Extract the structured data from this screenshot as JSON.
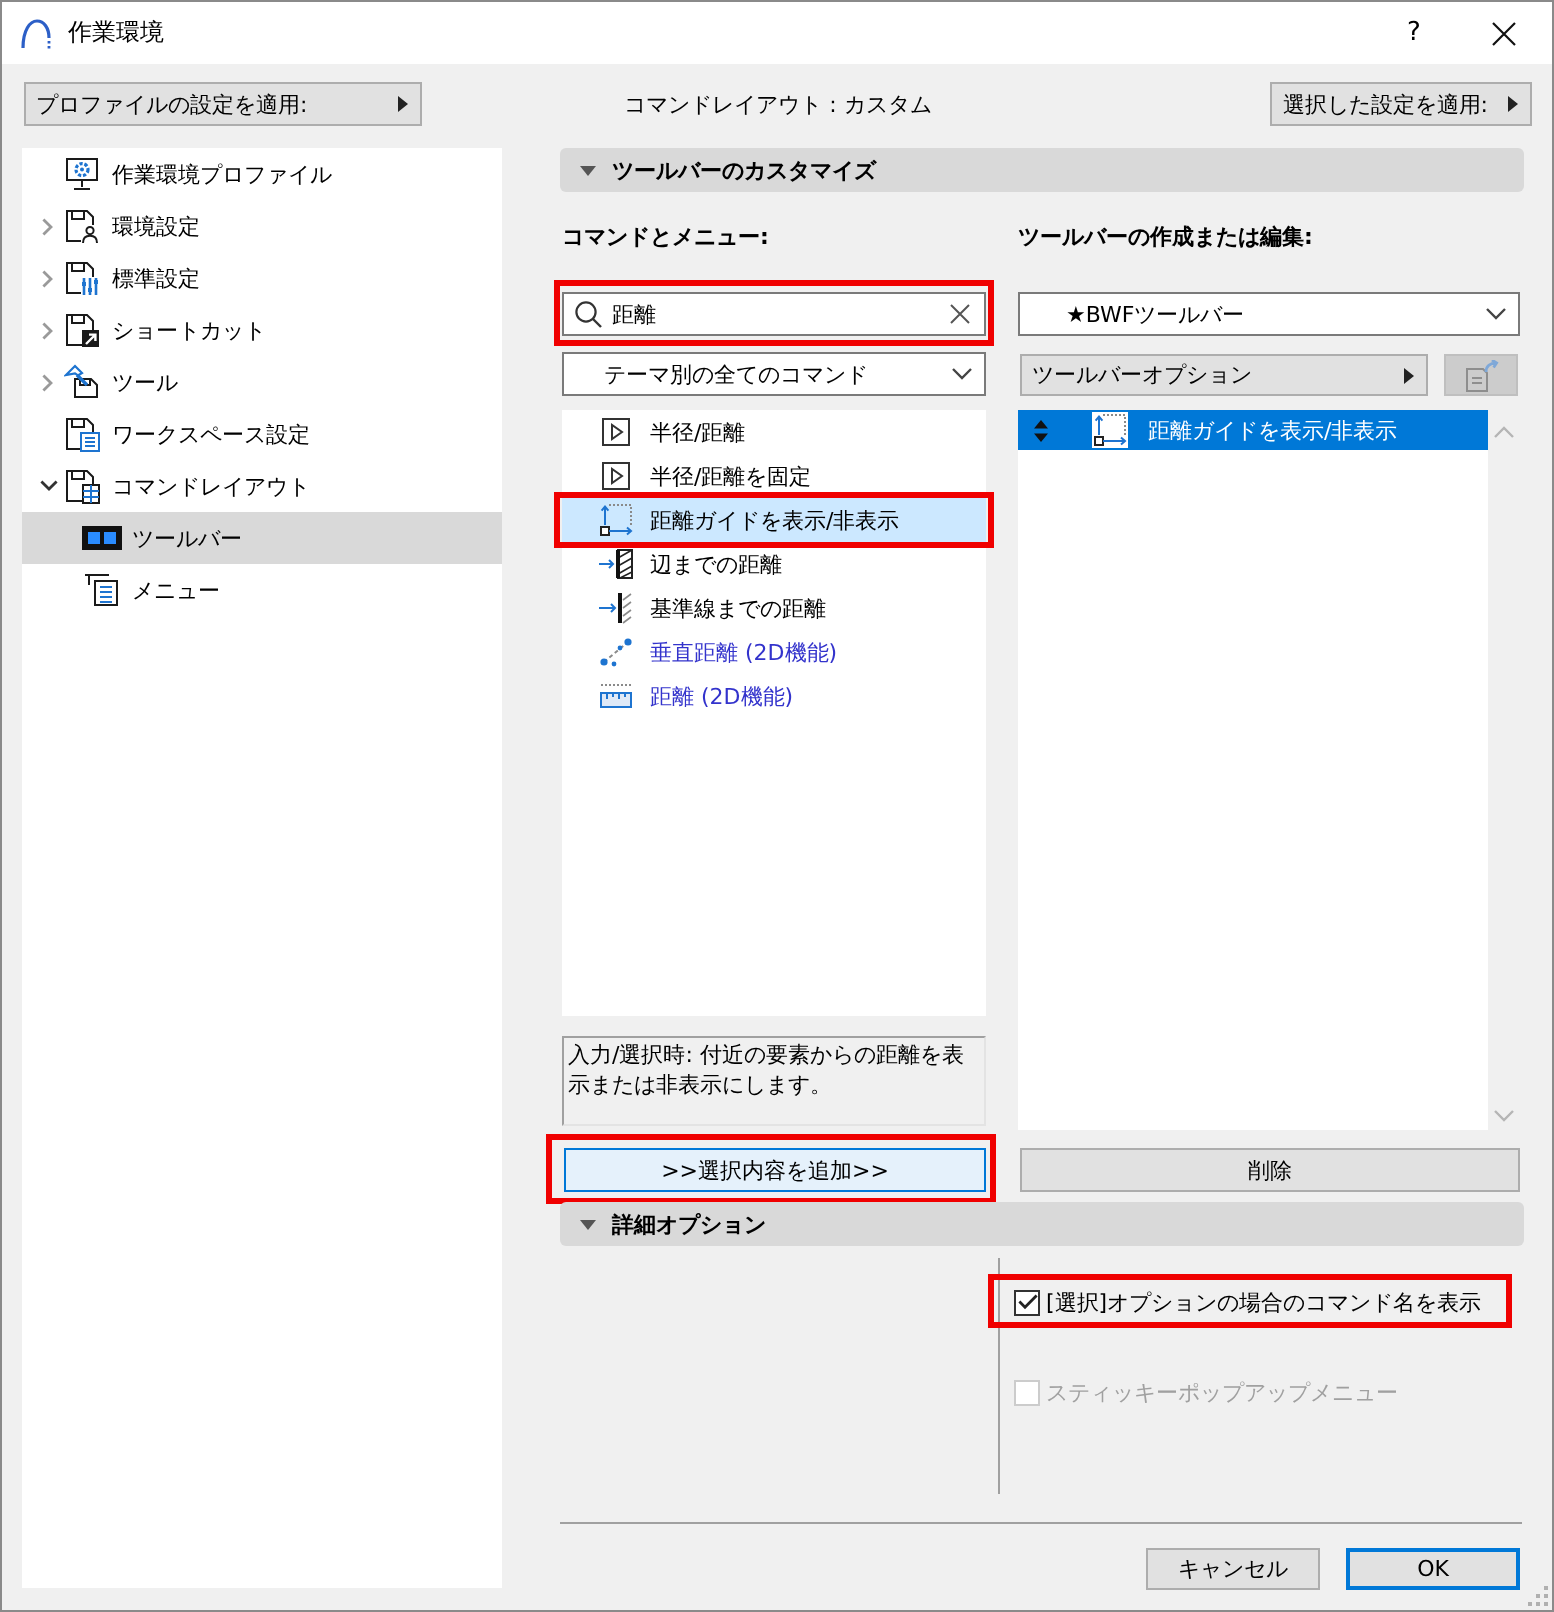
{
  "window": {
    "title": "作業環境",
    "help_button": "?"
  },
  "toolbar": {
    "profile_button": "プロファイルの設定を適用:",
    "layout_status": "コマンドレイアウト : カスタム",
    "apply_button": "選択した設定を適用:"
  },
  "sidebar": {
    "items": [
      {
        "label": "作業環境プロファイル",
        "selected": false
      },
      {
        "label": "環境設定",
        "expanded": false,
        "selected": false
      },
      {
        "label": "標準設定",
        "expanded": false,
        "selected": false
      },
      {
        "label": "ショートカット",
        "expanded": false,
        "selected": false
      },
      {
        "label": "ツール",
        "expanded": false,
        "selected": false
      },
      {
        "label": "ワークスペース設定",
        "selected": false
      },
      {
        "label": "コマンドレイアウト",
        "expanded": true,
        "selected": false,
        "children": [
          {
            "label": "ツールバー",
            "selected": true
          },
          {
            "label": "メニュー",
            "selected": false
          }
        ]
      }
    ]
  },
  "customize_section": {
    "title": "ツールバーのカスタマイズ",
    "expanded": true,
    "commands": {
      "label": "コマンドとメニュー:",
      "search": {
        "value": "距離",
        "highlighted": true
      },
      "filter": "テーマ別の全てのコマンド",
      "items": [
        {
          "label": "半径/距離",
          "color": "#000000",
          "selected": false,
          "highlighted": false
        },
        {
          "label": "半径/距離を固定",
          "color": "#000000",
          "selected": false,
          "highlighted": false
        },
        {
          "label": "距離ガイドを表示/非表示",
          "color": "#000000",
          "selected": true,
          "highlighted": true
        },
        {
          "label": "辺までの距離",
          "color": "#000000",
          "selected": false,
          "highlighted": false
        },
        {
          "label": "基準線までの距離",
          "color": "#000000",
          "selected": false,
          "highlighted": false
        },
        {
          "label": "垂直距離 (2D機能)",
          "color": "#3333cc",
          "selected": false,
          "highlighted": false
        },
        {
          "label": "距離 (2D機能)",
          "color": "#3333cc",
          "selected": false,
          "highlighted": false
        }
      ],
      "description": "入力/選択時: 付近の要素からの距離を表示または非表示にします。",
      "add_button": {
        "label": ">>選択内容を追加>>",
        "focused": true,
        "highlighted": true
      }
    },
    "toolbar_edit": {
      "label": "ツールバーの作成または編集:",
      "toolbar": "★BWFツールバー",
      "options_button": "ツールバーオプション",
      "export_button": {
        "disabled": true
      },
      "items": [
        {
          "label": "距離ガイドを表示/非表示",
          "selected": true
        }
      ],
      "delete_button": "削除"
    }
  },
  "advanced_section": {
    "title": "詳細オプション",
    "expanded": true,
    "options": [
      {
        "label": "[選択]オプションの場合のコマンド名を表示",
        "checked": true,
        "disabled": false,
        "highlighted": true
      },
      {
        "label": "スティッキーポップアップメニュー",
        "checked": false,
        "disabled": true,
        "highlighted": false
      }
    ]
  },
  "buttons": [
    {
      "label": "キャンセル",
      "default": false
    },
    {
      "label": "OK",
      "default": true
    }
  ]
}
